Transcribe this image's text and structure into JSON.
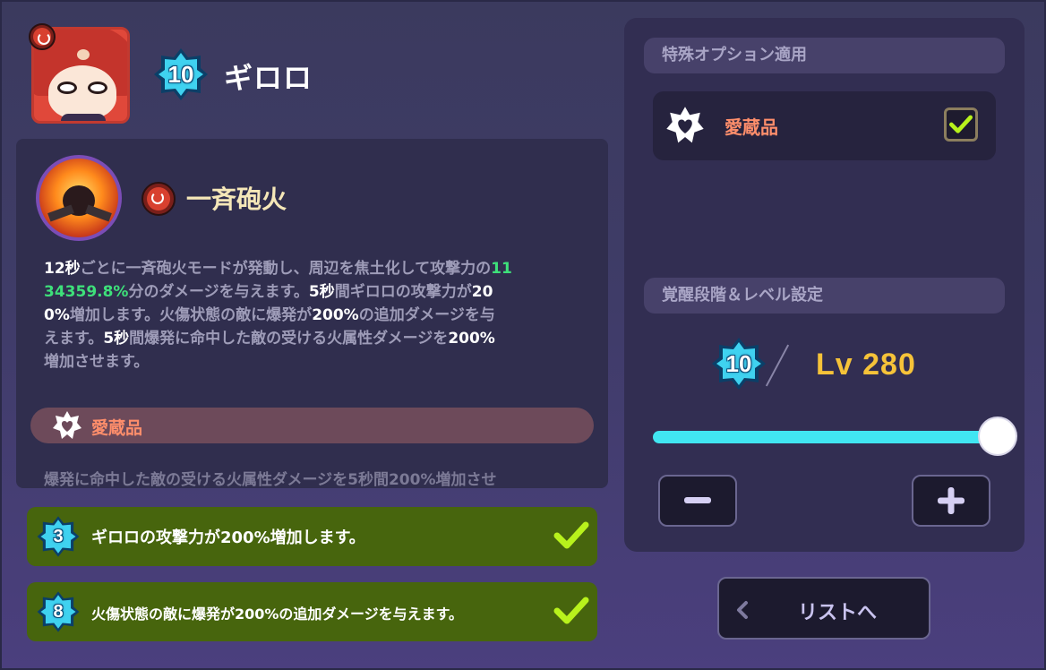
{
  "character": {
    "name": "ギロロ",
    "level_badge": "10",
    "element": "fire-icon"
  },
  "skill": {
    "name": "一斉砲火",
    "description_parts": [
      {
        "text": "12秒",
        "style": "w"
      },
      {
        "text": "ごとに一斉砲火モードが発動し、周辺を焦土化して攻撃力の",
        "style": "d"
      },
      {
        "text": "11",
        "style": "g"
      },
      {
        "text": "34359.8%",
        "style": "g"
      },
      {
        "text": "分のダメージを与えます。",
        "style": "w"
      },
      {
        "text": "5秒",
        "style": "w"
      },
      {
        "text": "間ギロロの攻撃力が",
        "style": "d"
      },
      {
        "text": "20",
        "style": "w"
      },
      {
        "text": "0%増加します。火傷状態の敵に爆発が",
        "style": "w"
      },
      {
        "text": "200%",
        "style": "w"
      },
      {
        "text": "の追加ダメージを与",
        "style": "w"
      },
      {
        "text": "えます。",
        "style": "d"
      },
      {
        "text": "5秒",
        "style": "w"
      },
      {
        "text": "間爆発に命中した敵の受ける火属性ダメージを",
        "style": "w"
      },
      {
        "text": "200%",
        "style": "w"
      },
      {
        "text": "増加させます。",
        "style": "d"
      }
    ],
    "line1": "12秒ごとに一斉砲火モードが発動し、周辺を焦土化して攻撃力の11",
    "line2": "34359.8%分のダメージを与えます。5秒間ギロロの攻撃力が20",
    "line3": "0%増加します。火傷状態の敵に爆発が200%の追加ダメージを与",
    "line4": "えます。5秒間爆発に命中した敵の受ける火属性ダメージを200%",
    "line5": "増加させます。",
    "treasure_label": "愛蔵品",
    "treasure_desc": "爆発に命中した敵の受ける火属性ダメージを5秒間200%増加させ"
  },
  "bonuses": [
    {
      "level": "3",
      "text": "ギロロの攻撃力が200%増加します。",
      "checked": true
    },
    {
      "level": "8",
      "text": "火傷状態の敵に爆発が200%の追加ダメージを与えます。",
      "checked": true
    }
  ],
  "options": {
    "header": "特殊オプション適用",
    "treasure_label": "愛蔵品",
    "treasure_checked": true
  },
  "awakening": {
    "header": "覚醒段階＆レベル設定",
    "stage": "10",
    "level_text": "Lv 280",
    "slider_fraction": 1.0,
    "minus_label": "−",
    "plus_label": "+"
  },
  "nav": {
    "list_button": "リストへ"
  },
  "colors": {
    "accent_cyan": "#41e6f2",
    "level_gold": "#f6c339",
    "treasure_orange": "#ff8e6b",
    "bonus_green": "#47650d",
    "check_lime": "#b8f21c"
  }
}
